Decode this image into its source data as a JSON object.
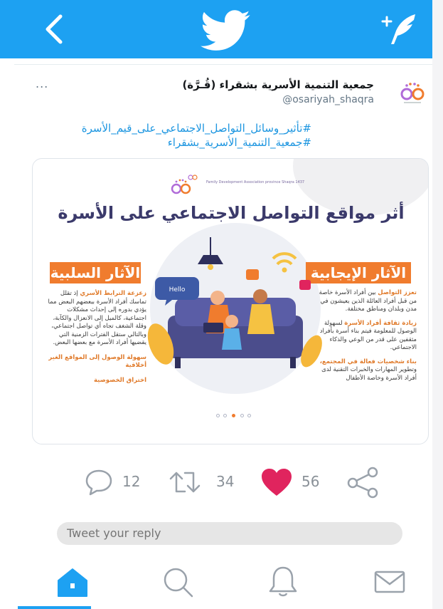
{
  "colors": {
    "brand": "#1da1f2",
    "link": "#1b95e0",
    "like": "#e0245e",
    "accent_orange": "#f07c2e",
    "title_navy": "#3b3a6b"
  },
  "topbar": {
    "back_icon": "chevron-left-icon",
    "logo_icon": "twitter-bird-icon",
    "compose_icon": "compose-plus-feather-icon"
  },
  "tweet": {
    "author_name": "جمعية التنمية الأسرية بشقراء (قُـرَّة)",
    "author_handle": "@osariyah_shaqra",
    "more_label": "...",
    "hashtags": [
      "#تأثير_وسائل_التواصل_الاجتماعي_على_قيم_الأسرة",
      "#جمعية_التنمية_الأسرية_بشقراء"
    ]
  },
  "image": {
    "title": "أثر مواقع التواصل الاجتماعي على الأسرة",
    "org_caption": "Family Development Association province Shaqra 1437",
    "bubble_text": "Hello",
    "negative": {
      "heading": "الآثار السلبية",
      "items": [
        {
          "lead": "زعزعة الترابط الأسري",
          "body": "إذ تقلل تماسك أفراد الأسرة ببعضهم البعض مما يؤدي بدوره إلى إحداث مشكلات اجتماعية، كالميل إلى الانعزال والكآبة، وقلة الشغف تجاه أي تواصل اجتماعي، وبالتالي ستقل الفترات الزمنية التي يقضيها أفراد الأسرة مع بعضها البعض."
        },
        {
          "lead": "سهولة الوصول إلى المواقع الغير أخلاقية",
          "body": ""
        },
        {
          "lead": "اختراق الخصوصية",
          "body": ""
        }
      ]
    },
    "positive": {
      "heading": "الآثار الإيجابية",
      "items": [
        {
          "lead": "تعزز التواصل",
          "body": "بين أفراد الأسرة خاصة من قبل أفراد العائلة الذين يعيشون في مدن وبلدان ومناطق مختلفة."
        },
        {
          "lead": "زيادة ثقافة أفراد الأسرة",
          "body": "لسهولة الوصول للمعلومة فيتم بناء أسرة بأفراد مثقفين على قدر من الوعي والذكاء الاجتماعي."
        },
        {
          "lead": "بناء شخصيات فعالة في المجتمع،",
          "body": "وتطوير المهارات والخبرات التقنية لدى أفراد الأسرة وخاصة الأطفال"
        }
      ]
    },
    "carousel": {
      "count": 5,
      "active_index": 2
    }
  },
  "actions": {
    "replies": "12",
    "retweets": "34",
    "likes": "56",
    "reply_icon": "reply-bubble-icon",
    "retweet_icon": "retweet-icon",
    "like_icon": "heart-icon",
    "share_icon": "share-icon"
  },
  "reply_box": {
    "placeholder": "Tweet your reply"
  },
  "bottom_nav": {
    "items": [
      "home-icon",
      "search-icon",
      "notifications-bell-icon",
      "messages-envelope-icon"
    ],
    "active": "home"
  }
}
